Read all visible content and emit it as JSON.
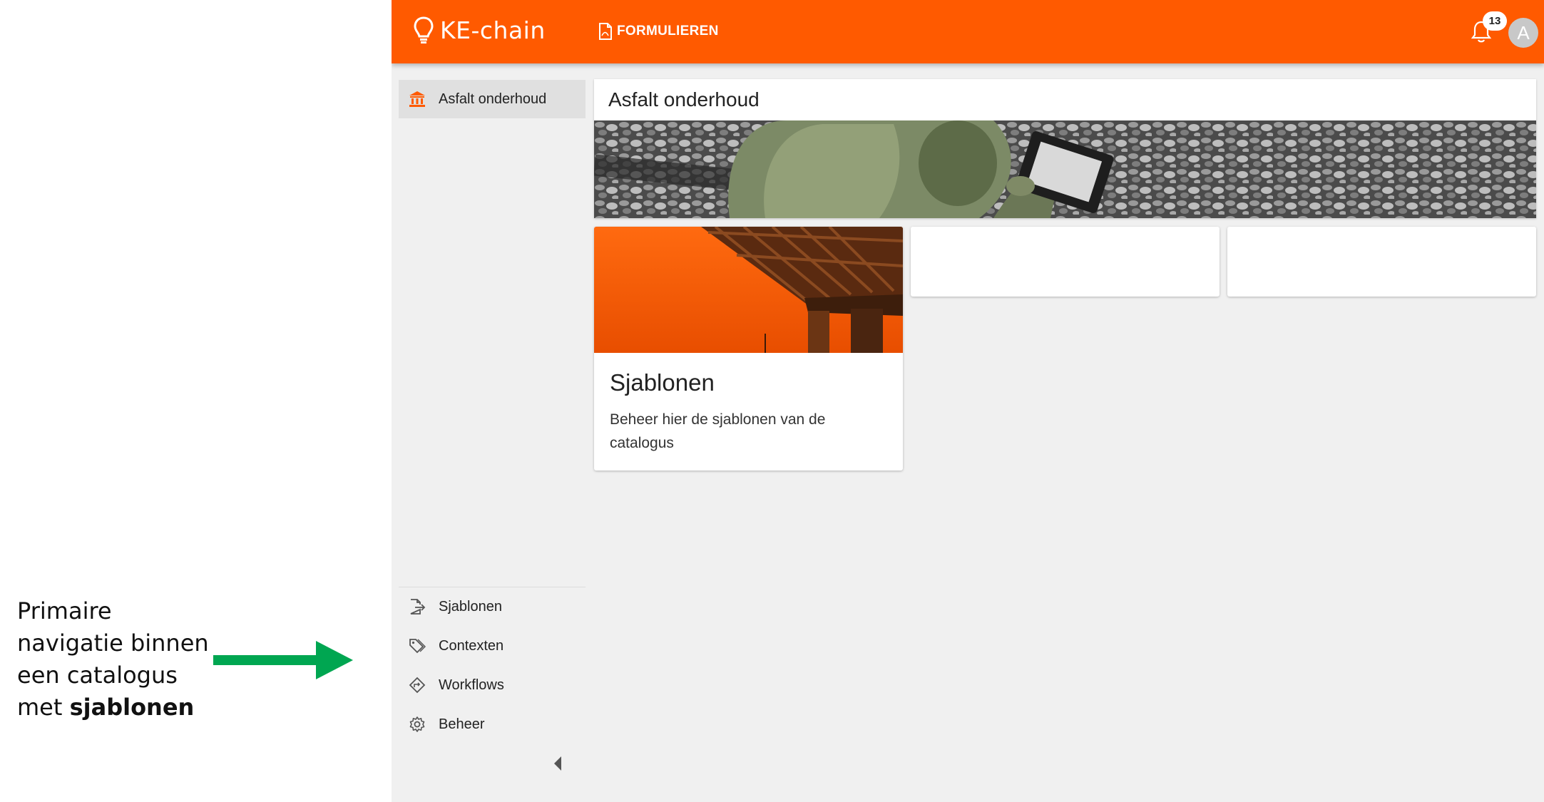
{
  "annotation": {
    "line1": "Primaire",
    "line2": "navigatie binnen",
    "line3": "een catalogus",
    "line4_prefix": "met ",
    "line4_bold": "sjablonen",
    "arrow_color": "#00a651"
  },
  "app": {
    "brand": "KE-chain",
    "accent_color": "#ff5a00",
    "top_nav": {
      "forms_label": "FORMULIEREN",
      "forms_icon": "pdf-file-icon"
    },
    "notifications": {
      "count": "13",
      "icon": "bell-icon"
    },
    "avatar_initial": "A"
  },
  "sidebar": {
    "active_item": {
      "label": "Asfalt onderhoud",
      "icon": "bank-icon"
    },
    "items": [
      {
        "label": "Sjablonen",
        "icon": "file-export-icon"
      },
      {
        "label": "Contexten",
        "icon": "tags-icon"
      },
      {
        "label": "Workflows",
        "icon": "workflow-diamond-icon"
      },
      {
        "label": "Beheer",
        "icon": "gear-icon"
      }
    ],
    "collapse_icon": "caret-left-icon"
  },
  "main": {
    "page_title": "Asfalt onderhoud",
    "cards": [
      {
        "title": "Sjablonen",
        "description": "Beheer hier de sjablonen van de catalogus"
      }
    ]
  }
}
